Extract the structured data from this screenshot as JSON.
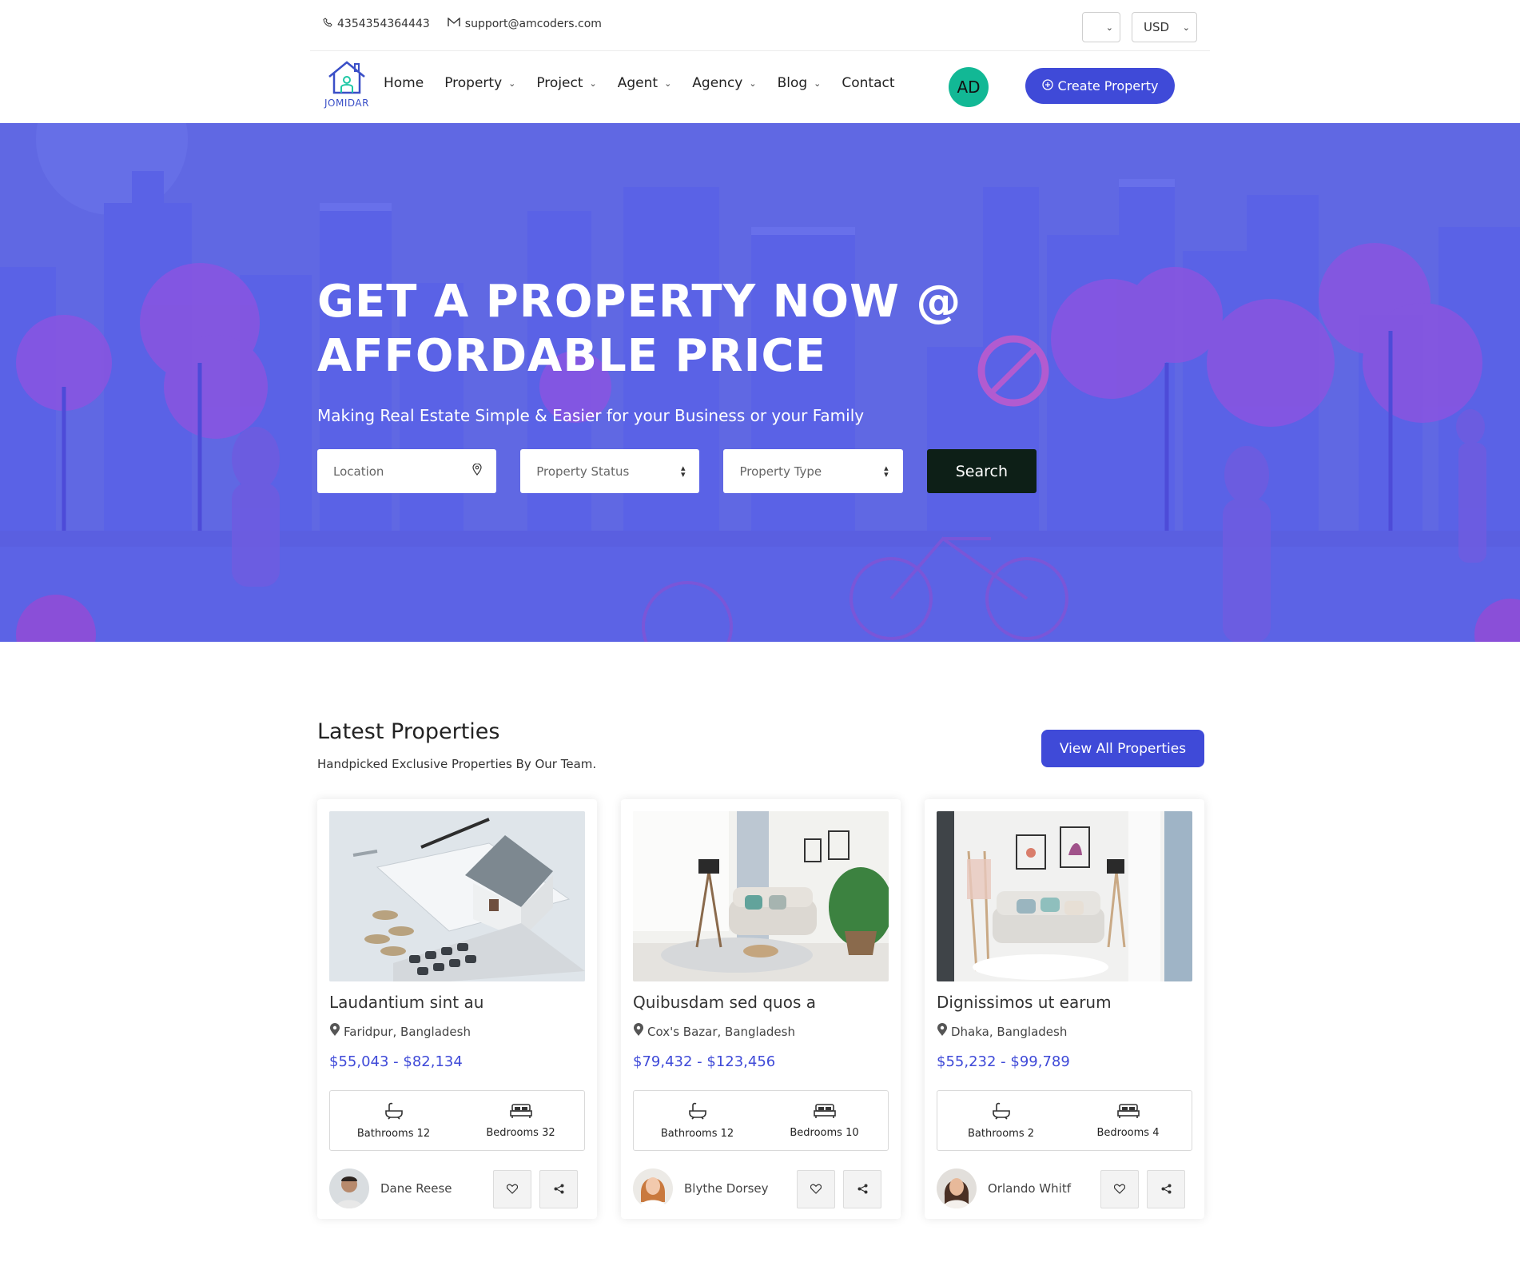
{
  "topbar": {
    "phone": "4354354364443",
    "email": "support@amcoders.com",
    "language_value": "",
    "currency_value": "USD"
  },
  "nav": {
    "logo_text": "JOMIDAR",
    "items": [
      {
        "label": "Home",
        "has_caret": false
      },
      {
        "label": "Property",
        "has_caret": true
      },
      {
        "label": "Project",
        "has_caret": true
      },
      {
        "label": "Agent",
        "has_caret": true
      },
      {
        "label": "Agency",
        "has_caret": true
      },
      {
        "label": "Blog",
        "has_caret": true
      },
      {
        "label": "Contact",
        "has_caret": false
      }
    ],
    "avatar_initials": "AD",
    "create_label": "Create Property"
  },
  "hero": {
    "title_line1": "GET A PROPERTY NOW @",
    "title_line2": "AFFORDABLE PRICE",
    "subtitle": "Making Real Estate Simple & Easier for your Business or your Family",
    "location_placeholder": "Location",
    "status_label": "Property Status",
    "type_label": "Property Type",
    "search_label": "Search"
  },
  "latest": {
    "title": "Latest Properties",
    "subtitle": "Handpicked Exclusive Properties By Our Team.",
    "view_all_label": "View All Properties",
    "cards": [
      {
        "title": "Laudantium sint au",
        "location": "Faridpur, Bangladesh",
        "price": "$55,043 - $82,134",
        "bathrooms": "Bathrooms 12",
        "bedrooms": "Bedrooms 32",
        "agent": "Dane Reese"
      },
      {
        "title": "Quibusdam sed quos a",
        "location": "Cox's Bazar, Bangladesh",
        "price": "$79,432 - $123,456",
        "bathrooms": "Bathrooms 12",
        "bedrooms": "Bedrooms 10",
        "agent": "Blythe Dorsey"
      },
      {
        "title": "Dignissimos ut earum",
        "location": "Dhaka, Bangladesh",
        "price": "$55,232 - $99,789",
        "bathrooms": "Bathrooms 2",
        "bedrooms": "Bedrooms 4",
        "agent": "Orlando Whitf"
      }
    ]
  },
  "colors": {
    "accent": "#3f4ad8",
    "hero_bg": "#5f68e2",
    "avatar_bg": "#12b895",
    "search_btn": "#0d1f17"
  }
}
